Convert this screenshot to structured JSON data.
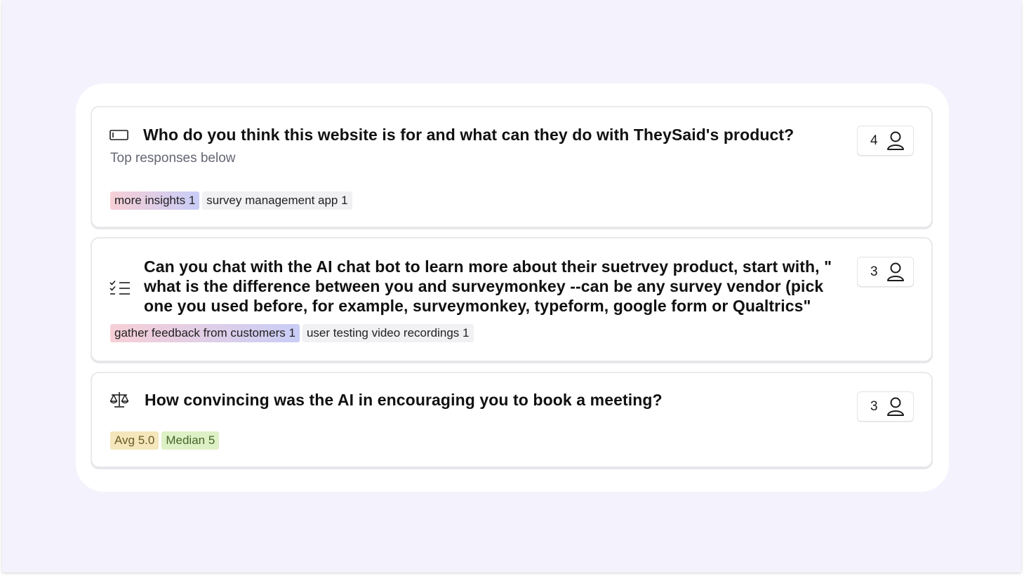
{
  "questions": [
    {
      "title": "Who do you think this website is for and what can they do with TheySaid's product?",
      "subtitle": "Top responses below",
      "icon": "text-input-icon",
      "respondents": "4",
      "tags": [
        "more insights 1",
        "survey management app 1"
      ]
    },
    {
      "title": "Can you chat with the AI chat bot to learn more about their suetrvey product, start with, \" what is the difference between you and surveymonkey --can be any survey vendor (pick one you used before, for example, surveymonkey, typeform, google form or Qualtrics\"",
      "icon": "checklist-icon",
      "respondents": "3",
      "tags": [
        "gather feedback from customers 1",
        "user testing video recordings 1"
      ]
    },
    {
      "title": "How convincing was the AI in encouraging you to book a meeting?",
      "icon": "scale-icon",
      "respondents": "3",
      "tags": [
        "Avg 5.0",
        "Median 5"
      ]
    }
  ]
}
